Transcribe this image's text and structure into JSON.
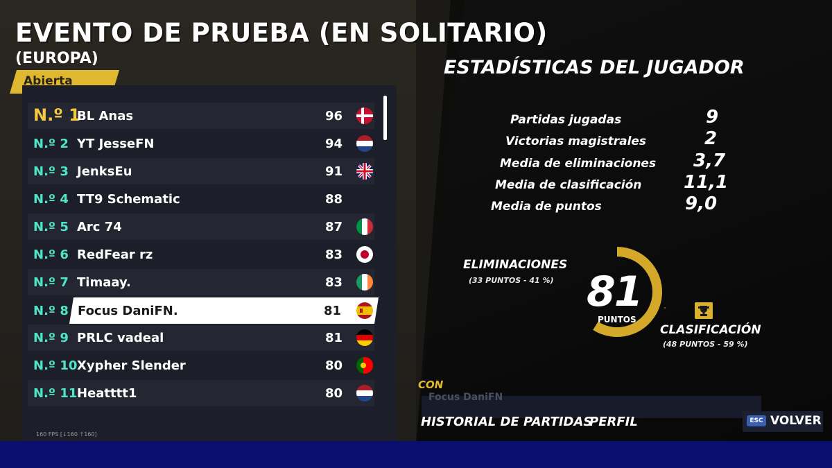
{
  "header": {
    "title": "EVENTO DE PRUEBA (EN SOLITARIO)",
    "region": "(EUROPA)",
    "tab": "Abierta"
  },
  "leaderboard": [
    {
      "rank": "N.º 1",
      "name": "BL Anas",
      "score": "96",
      "flag": "denmark"
    },
    {
      "rank": "N.º 2",
      "name": "YT JesseFN",
      "score": "94",
      "flag": "netherlands"
    },
    {
      "rank": "N.º 3",
      "name": "JenksEu",
      "score": "91",
      "flag": "united-kingdom"
    },
    {
      "rank": "N.º 4",
      "name": "TT9 Schematic",
      "score": "88",
      "flag": ""
    },
    {
      "rank": "N.º 5",
      "name": "Arc 74",
      "score": "87",
      "flag": "italy"
    },
    {
      "rank": "N.º 6",
      "name": "RedFear rz",
      "score": "83",
      "flag": "japan"
    },
    {
      "rank": "N.º 7",
      "name": "Timaay.",
      "score": "83",
      "flag": "ireland"
    },
    {
      "rank": "N.º 8",
      "name": "Focus DaniFN.",
      "score": "81",
      "flag": "spain"
    },
    {
      "rank": "N.º 9",
      "name": "PRLC vadeal",
      "score": "81",
      "flag": "germany"
    },
    {
      "rank": "N.º 10",
      "name": "Xypher Slender",
      "score": "80",
      "flag": "portugal"
    },
    {
      "rank": "N.º 11",
      "name": "Heatttt1",
      "score": "80",
      "flag": "netherlands"
    }
  ],
  "fps": "160 FPS [↓160 ↑160]",
  "stats": {
    "title": "ESTADÍSTICAS DEL JUGADOR",
    "items": [
      {
        "label": "Partidas jugadas",
        "value": "9"
      },
      {
        "label": "Victorias magistrales",
        "value": "2"
      },
      {
        "label": "Media de eliminaciones",
        "value": "3,7"
      },
      {
        "label": "Media de clasificación",
        "value": "11,1"
      },
      {
        "label": "Media de puntos",
        "value": "9,0"
      }
    ],
    "total_points": "81",
    "total_points_label": "PUNTOS",
    "eliminations_label": "ELIMINACIONES",
    "eliminations_detail": "(33 PUNTOS - 41 %)",
    "placement_label": "CLASIFICACIÓN",
    "placement_detail": "(48 PUNTOS - 59 %)",
    "placement_share": 0.59
  },
  "footer": {
    "con_label": "CON",
    "con_value": "Focus DaniFN",
    "history": "HISTORIAL DE PARTIDAS",
    "profile": "PERFIL",
    "esc_key": "ESC",
    "back": "VOLVER"
  },
  "colors": {
    "gold": "#e0b830",
    "teal": "#4ee6c9",
    "bottom_bar": "#0a0f6e"
  }
}
